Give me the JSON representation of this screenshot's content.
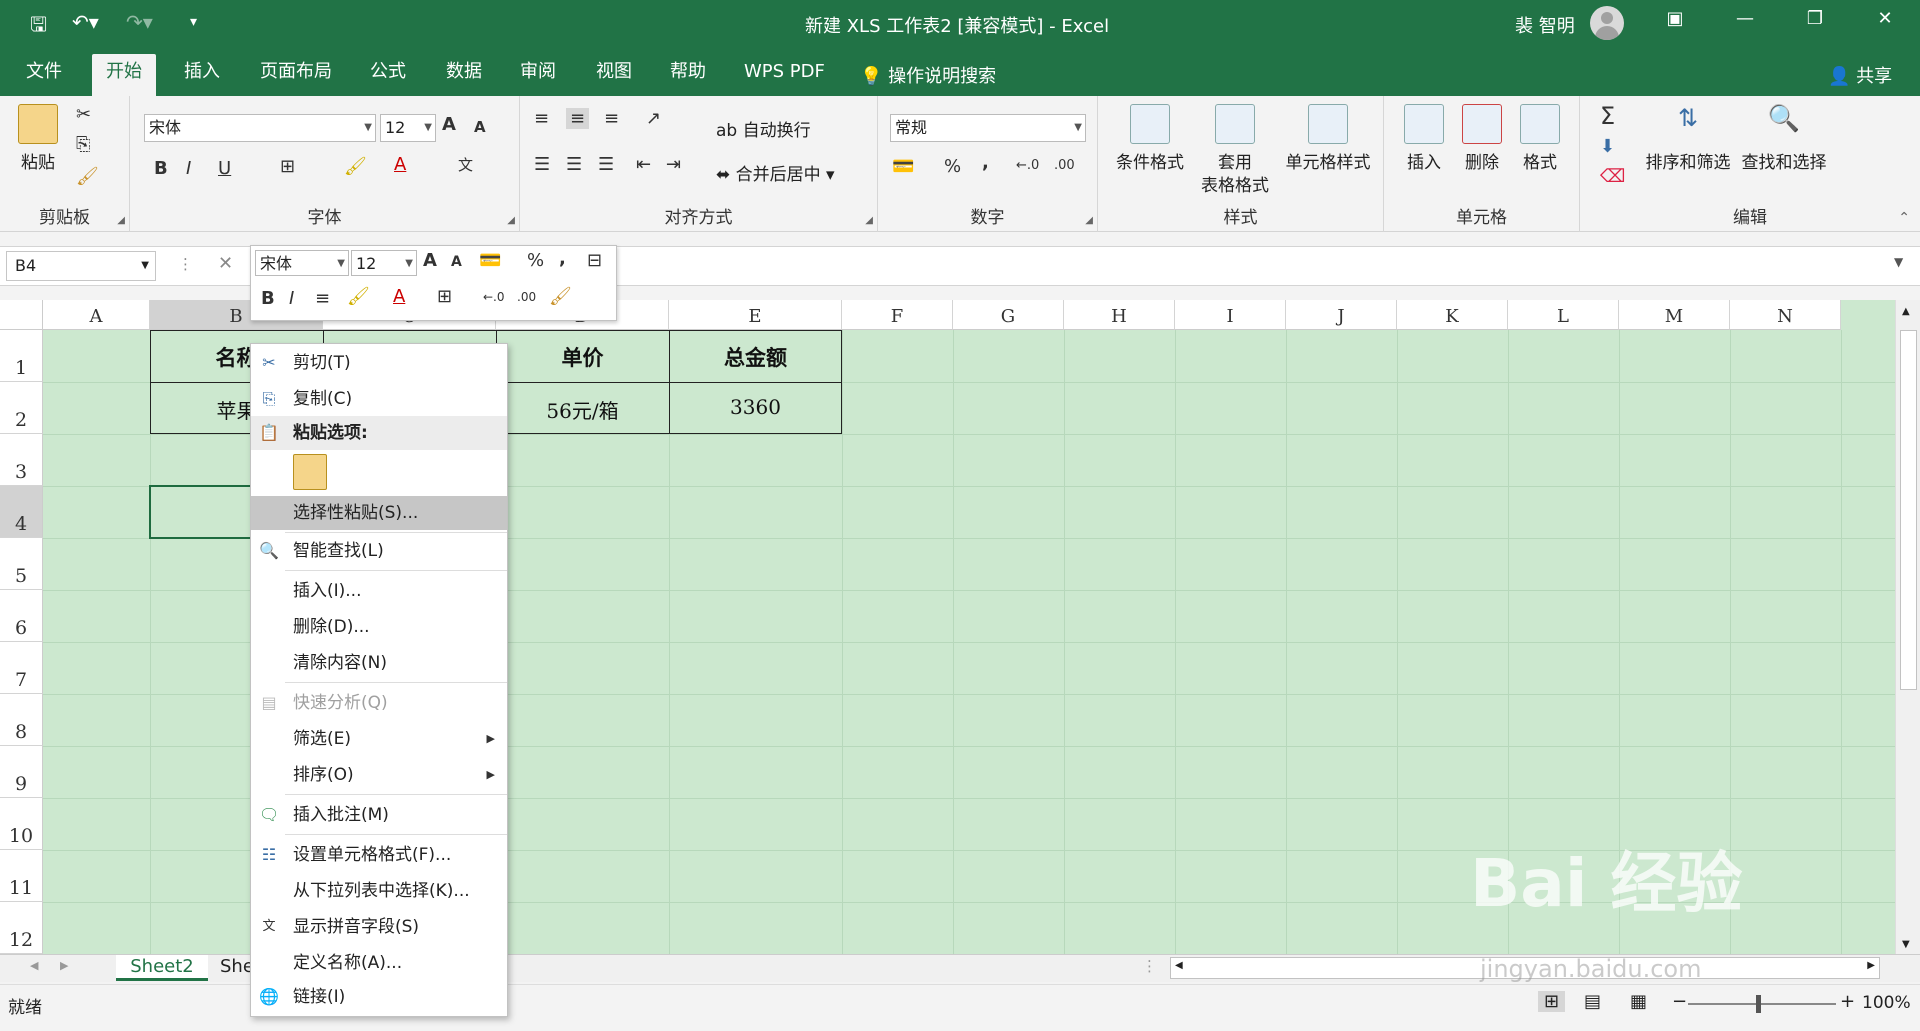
{
  "window": {
    "title": "新建 XLS 工作表2  [兼容模式]  -  Excel",
    "user_name": "裴 智明"
  },
  "tabs": [
    "文件",
    "开始",
    "插入",
    "页面布局",
    "公式",
    "数据",
    "审阅",
    "视图",
    "帮助",
    "WPS PDF"
  ],
  "tell_me": "操作说明搜索",
  "share": "共享",
  "ribbon": {
    "clipboard": {
      "label": "剪贴板",
      "paste": "粘贴"
    },
    "font": {
      "label": "字体",
      "name": "宋体",
      "size": "12",
      "bold": "B",
      "italic": "I",
      "underline": "U",
      "increase": "A",
      "decrease": "A"
    },
    "alignment": {
      "label": "对齐方式",
      "wrap": "自动换行",
      "merge": "合并后居中"
    },
    "number": {
      "label": "数字",
      "format": "常规",
      "percent": "%",
      "comma": ",",
      "inc_dec": "←.0",
      "dec_dec": ".00"
    },
    "styles": {
      "label": "样式",
      "conditional": "条件格式",
      "table_fmt_1": "套用",
      "table_fmt_2": "表格格式",
      "cell_styles": "单元格样式"
    },
    "cells": {
      "label": "单元格",
      "insert": "插入",
      "delete": "删除",
      "format": "格式"
    },
    "editing": {
      "label": "编辑",
      "sort_filter": "排序和筛选",
      "find_select": "查找和选择",
      "sum": "Σ"
    }
  },
  "namebox": "B4",
  "columns": [
    "A",
    "B",
    "C",
    "D",
    "E",
    "F",
    "G",
    "H",
    "I",
    "J",
    "K",
    "L",
    "M",
    "N"
  ],
  "rows": [
    "1",
    "2",
    "3",
    "4",
    "5",
    "6",
    "7",
    "8",
    "9",
    "10",
    "11",
    "12"
  ],
  "table": {
    "headers": [
      "名称",
      "",
      "单价",
      "总金额"
    ],
    "values": [
      "苹果",
      "",
      "56元/箱",
      "3360"
    ]
  },
  "mini_toolbar": {
    "font": "宋体",
    "size": "12",
    "bold": "B",
    "italic": "I",
    "percent": "%",
    "comma": ","
  },
  "context_menu": {
    "cut": "剪切(T)",
    "copy": "复制(C)",
    "paste_options": "粘贴选项:",
    "paste_special": "选择性粘贴(S)...",
    "smart_lookup": "智能查找(L)",
    "insert": "插入(I)...",
    "delete": "删除(D)...",
    "clear": "清除内容(N)",
    "quick_analysis": "快速分析(Q)",
    "filter": "筛选(E)",
    "sort": "排序(O)",
    "insert_comment": "插入批注(M)",
    "format_cells": "设置单元格格式(F)...",
    "pick_list": "从下拉列表中选择(K)...",
    "phonetic": "显示拼音字段(S)",
    "define_name": "定义名称(A)...",
    "link": "链接(I)"
  },
  "sheets": {
    "active": "Sheet2",
    "other": "She"
  },
  "status": {
    "ready": "就绪",
    "zoom": "100%"
  },
  "watermark": {
    "brand": "Bai 经验",
    "url": "jingyan.baidu.com"
  }
}
